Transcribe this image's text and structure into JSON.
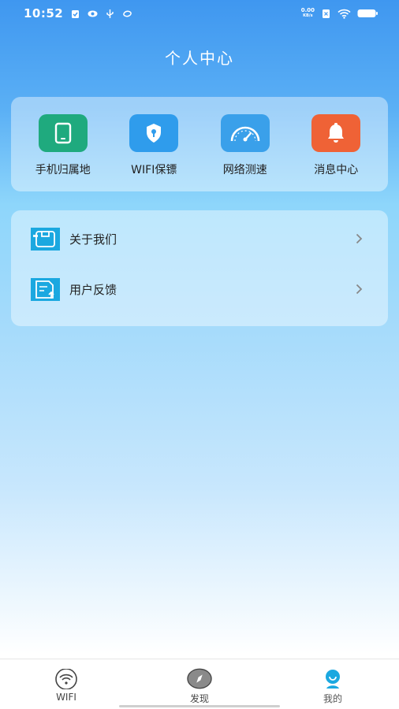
{
  "status_bar": {
    "time": "10:52",
    "net_speed_value": "0.00",
    "net_speed_unit": "KB/s",
    "left_icons": [
      "clipboard-icon",
      "eye-icon",
      "usb-icon",
      "sync-icon"
    ],
    "right_icons": [
      "sim-icon",
      "wifi-signal-icon",
      "battery-icon"
    ]
  },
  "header": {
    "title": "个人中心"
  },
  "quick_actions": [
    {
      "label": "手机归属地",
      "icon": "phone-icon",
      "color": "#1faa7e"
    },
    {
      "label": "WIFI保镖",
      "icon": "shield-icon",
      "color": "#2f9cec"
    },
    {
      "label": "网络测速",
      "icon": "speedometer-icon",
      "color": "#3aa0ea"
    },
    {
      "label": "消息中心",
      "icon": "bell-icon",
      "color": "#ef6236"
    }
  ],
  "menu": [
    {
      "label": "关于我们",
      "icon": "about-icon"
    },
    {
      "label": "用户反馈",
      "icon": "feedback-icon"
    }
  ],
  "tabs": [
    {
      "label": "WIFI",
      "icon": "wifi-icon"
    },
    {
      "label": "发现",
      "icon": "compass-icon"
    },
    {
      "label": "我的",
      "icon": "profile-icon",
      "active": true
    }
  ],
  "colors": {
    "accent": "#3f97f0",
    "menu_icon": "#1ba8e0",
    "tab_active": "#1ba8e0"
  }
}
